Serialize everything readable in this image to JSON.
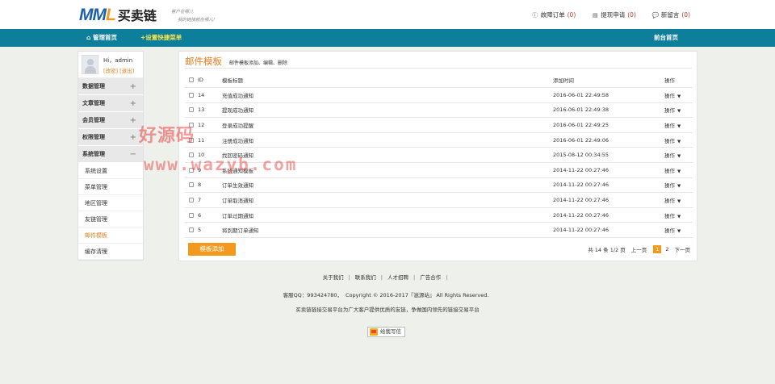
{
  "header": {
    "logo_mml_1": "MM",
    "logo_mml_2": "L",
    "logo_cn": "买卖链",
    "slogan_line1": "客户在哪儿",
    "slogan_line2": "我的链接就在哪儿!",
    "links": [
      {
        "icon": "info-circle-icon",
        "label": "故障订单",
        "count": "(0)"
      },
      {
        "icon": "card-icon",
        "label": "提现申请",
        "count": "(0)"
      },
      {
        "icon": "chat-icon",
        "label": "新留言",
        "count": "(0)"
      }
    ]
  },
  "nav": {
    "home": "管理首页",
    "quick": "+设置快捷菜单",
    "front": "前台首页"
  },
  "sidebar": {
    "user_greeting": "Hi，admin",
    "user_links": "[改密] [退出]",
    "groups": [
      {
        "label": "数据管理",
        "toggle": "+"
      },
      {
        "label": "文章管理",
        "toggle": "+"
      },
      {
        "label": "会员管理",
        "toggle": "+"
      },
      {
        "label": "权限管理",
        "toggle": "+"
      },
      {
        "label": "系统管理",
        "toggle": "−"
      }
    ],
    "sub_items": [
      "系统设置",
      "菜单管理",
      "地区管理",
      "友链管理",
      "邮件模板",
      "缓存清理"
    ]
  },
  "main": {
    "title": "邮件模板",
    "subtitle": "邮件模板添加、编辑、删除",
    "columns": {
      "id": "ID",
      "title": "模板标题",
      "time": "添加时间",
      "op": "操作"
    },
    "rows": [
      {
        "id": "14",
        "title": "充值成功通知",
        "time": "2016-06-01 22:49:58",
        "op": "操作"
      },
      {
        "id": "13",
        "title": "提现成功通知",
        "time": "2016-06-01 22:49:38",
        "op": "操作"
      },
      {
        "id": "12",
        "title": "登录成功提醒",
        "time": "2016-06-01 22:49:25",
        "op": "操作"
      },
      {
        "id": "11",
        "title": "注册成功通知",
        "time": "2016-06-01 22:49:06",
        "op": "操作"
      },
      {
        "id": "10",
        "title": "找回密码通知",
        "time": "2015-08-12 00:34:55",
        "op": "操作"
      },
      {
        "id": "9",
        "title": "系统通知模板",
        "time": "2014-11-22 00:27:46",
        "op": "操作"
      },
      {
        "id": "8",
        "title": "订单生效通知",
        "time": "2014-11-22 00:27:46",
        "op": "操作"
      },
      {
        "id": "7",
        "title": "订单取消通知",
        "time": "2014-11-22 00:27:46",
        "op": "操作"
      },
      {
        "id": "6",
        "title": "订单过期通知",
        "time": "2014-11-22 00:27:46",
        "op": "操作"
      },
      {
        "id": "5",
        "title": "将到期订单通知",
        "time": "2014-11-22 00:27:46",
        "op": "操作"
      }
    ],
    "add_button": "模板添加",
    "pager": {
      "summary": "共 14 条 1/2 页",
      "prev": "上一页",
      "current": "1",
      "next_num": "2",
      "next": "下一页"
    }
  },
  "footer": {
    "links": [
      "关于我们",
      "联系我们",
      "人才招聘",
      "广告合作"
    ],
    "copyright_qq": "客服QQ：993424780，",
    "copyright": "Copyright © 2016-2017『滋源站』 All Rights Reserved.",
    "slogan": "买卖链链接交易平台为广大客户提供优质的友链，争做国内领先的链接交易平台",
    "message_button": "给我写信"
  },
  "watermark": {
    "line1": "好源码",
    "line2": "www.wazyb.com"
  }
}
